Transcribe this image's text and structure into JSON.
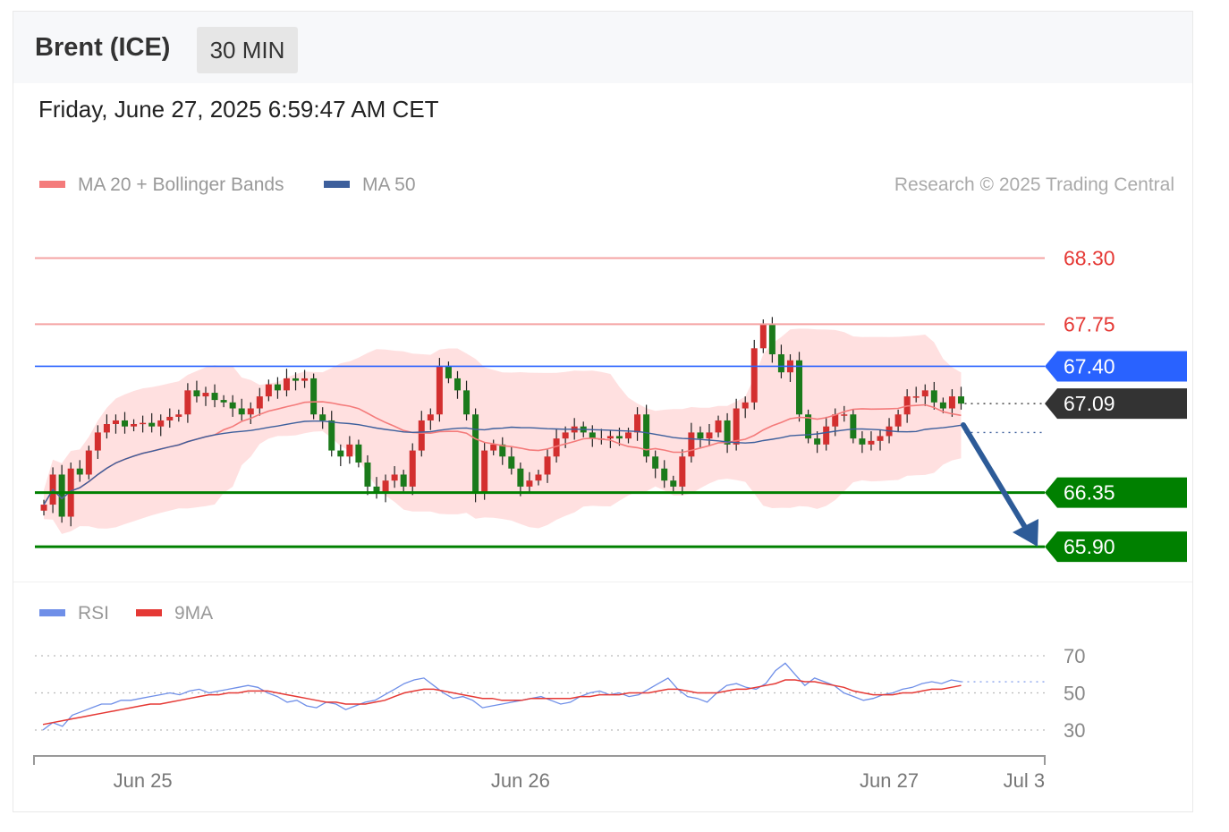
{
  "header": {
    "instrument": "Brent (ICE)",
    "timeframe": "30 MIN"
  },
  "datetime": "Friday, June 27, 2025 6:59:47 AM CET",
  "legend": {
    "ma20": "MA 20 + Bollinger Bands",
    "ma50": "MA 50",
    "rsi": "RSI",
    "rsi_ma": "9MA",
    "copyright": "Research © 2025 Trading Central"
  },
  "colors": {
    "up": "#d32f2f",
    "down": "#1b7a1b",
    "ma20": "#f47b7b",
    "ma50": "#3d5f9c",
    "band": "#ffd6d6",
    "resistance": "#f5a3a3",
    "pivot": "#2962ff",
    "support": "#008000",
    "last": "#333333",
    "arrow": "#2d5b98",
    "rsi": "#6f8fe8",
    "rsi_ma": "#e53935"
  },
  "chart_data": {
    "type": "candlestick",
    "y_axis": {
      "min": 65.7,
      "max": 68.75
    },
    "levels": [
      {
        "value": 68.3,
        "label": "68.30",
        "kind": "resistance"
      },
      {
        "value": 67.75,
        "label": "67.75",
        "kind": "resistance"
      },
      {
        "value": 67.4,
        "label": "67.40",
        "kind": "pivot"
      },
      {
        "value": 67.09,
        "label": "67.09",
        "kind": "last"
      },
      {
        "value": 66.35,
        "label": "66.35",
        "kind": "support"
      },
      {
        "value": 65.9,
        "label": "65.90",
        "kind": "support"
      }
    ],
    "x_ticks": [
      {
        "label": "Jun 25",
        "index": 11
      },
      {
        "label": "Jun 26",
        "index": 53
      },
      {
        "label": "Jun 27",
        "index": 94
      },
      {
        "label": "Jul 3",
        "index": 109
      }
    ],
    "bar_count": 112,
    "close": [
      66.25,
      66.5,
      66.15,
      66.55,
      66.5,
      66.7,
      66.85,
      66.92,
      66.95,
      66.9,
      66.92,
      66.93,
      66.9,
      66.95,
      66.98,
      67.0,
      67.2,
      67.15,
      67.18,
      67.12,
      67.1,
      67.05,
      67.0,
      67.05,
      67.15,
      67.25,
      67.2,
      67.3,
      67.28,
      67.3,
      67.0,
      66.95,
      66.7,
      66.65,
      66.75,
      66.6,
      66.4,
      66.35,
      66.45,
      66.5,
      66.4,
      66.7,
      66.95,
      67.0,
      67.4,
      67.3,
      67.2,
      67.0,
      66.35,
      66.7,
      66.75,
      66.65,
      66.55,
      66.4,
      66.45,
      66.5,
      66.65,
      66.8,
      66.85,
      66.9,
      66.85,
      66.8,
      66.8,
      66.82,
      66.8,
      66.85,
      67.0,
      66.65,
      66.55,
      66.45,
      66.4,
      66.65,
      66.85,
      66.8,
      66.85,
      66.95,
      66.75,
      67.05,
      67.1,
      67.55,
      67.75,
      67.5,
      67.35,
      67.45,
      67.0,
      66.8,
      66.75,
      66.9,
      67.0,
      67.0,
      66.8,
      66.75,
      66.78,
      66.82,
      66.9,
      67.0,
      67.15,
      67.15,
      67.2,
      67.1,
      67.05,
      67.15,
      67.09
    ],
    "ohlc_note": "candles reconstructed from close series",
    "rsi_axis": {
      "labels": [
        "70",
        "50",
        "30"
      ],
      "values": [
        70,
        50,
        30
      ]
    },
    "rsi": [
      30,
      34,
      32,
      38,
      40,
      42,
      44,
      44,
      46,
      46,
      47,
      48,
      49,
      50,
      49,
      51,
      52,
      50,
      51,
      52,
      53,
      54,
      53,
      50,
      48,
      45,
      46,
      43,
      42,
      45,
      44,
      41,
      43,
      45,
      46,
      49,
      52,
      55,
      57,
      58,
      54,
      50,
      47,
      48,
      46,
      42,
      43,
      44,
      45,
      46,
      47,
      48,
      46,
      44,
      45,
      48,
      50,
      51,
      49,
      50,
      48,
      49,
      52,
      55,
      58,
      52,
      48,
      47,
      45,
      50,
      54,
      55,
      53,
      52,
      55,
      62,
      66,
      60,
      54,
      58,
      56,
      54,
      50,
      48,
      46,
      47,
      49,
      50,
      52,
      53,
      55,
      56,
      55,
      57,
      56
    ],
    "rsi_ma": [
      33,
      34,
      35,
      36,
      37,
      38,
      39,
      40,
      41,
      42,
      43,
      44,
      44,
      45,
      46,
      47,
      48,
      49,
      49,
      50,
      50,
      51,
      51,
      51,
      50,
      49,
      48,
      47,
      46,
      45,
      45,
      44,
      44,
      44,
      45,
      46,
      48,
      50,
      51,
      52,
      52,
      51,
      50,
      49,
      48,
      47,
      47,
      46,
      46,
      46,
      47,
      47,
      47,
      47,
      47,
      48,
      48,
      49,
      49,
      49,
      50,
      50,
      50,
      51,
      52,
      52,
      51,
      50,
      50,
      50,
      51,
      52,
      52,
      53,
      54,
      55,
      57,
      57,
      56,
      56,
      55,
      54,
      53,
      51,
      50,
      49,
      49,
      49,
      50,
      50,
      51,
      52,
      52,
      53,
      54
    ]
  }
}
